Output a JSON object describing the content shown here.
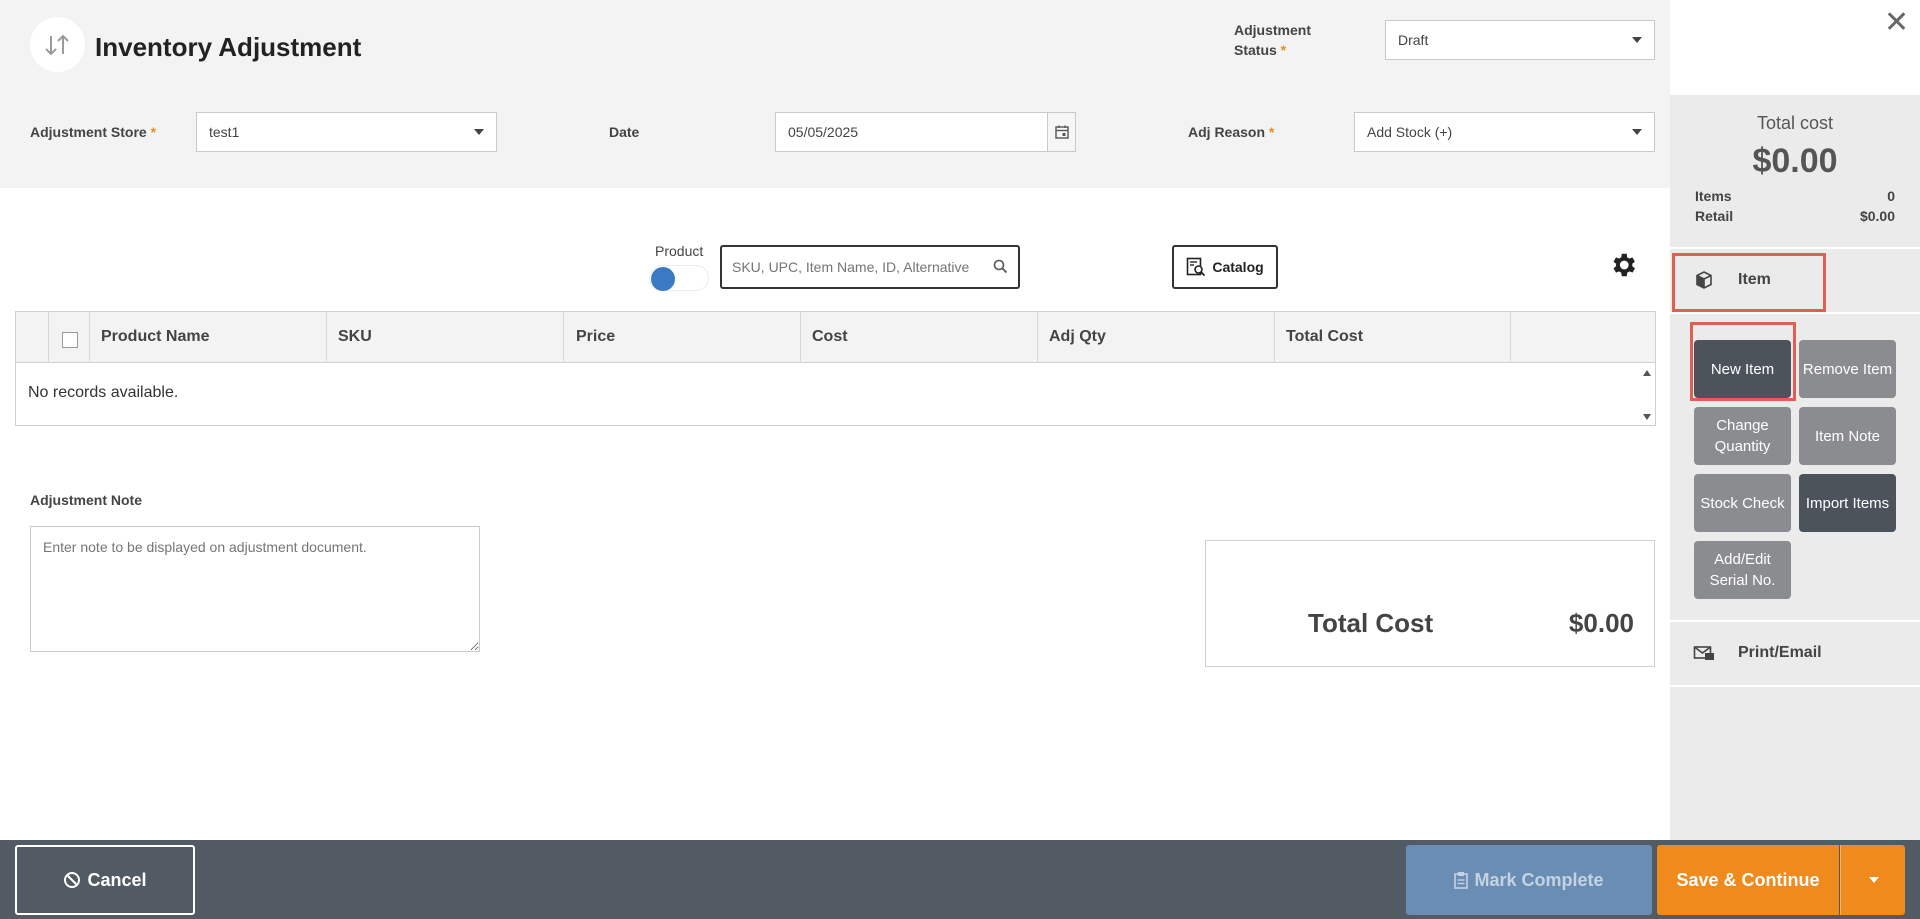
{
  "header": {
    "title": "Inventory Adjustment",
    "status_label_line1": "Adjustment",
    "status_label_line2": "Status",
    "status_value": "Draft",
    "close_symbol": "✕",
    "logo_icon": "swap-arrows-icon"
  },
  "form": {
    "store_label": "Adjustment Store",
    "store_value": "test1",
    "date_label": "Date",
    "date_value": "05/05/2025",
    "reason_label": "Adj Reason",
    "reason_value": "Add Stock (+)",
    "required_marker": "*",
    "required_color": "#f08a1c"
  },
  "search": {
    "toggle_label": "Product",
    "placeholder": "SKU, UPC, Item Name, ID, Alternative",
    "catalog_label": "Catalog"
  },
  "table": {
    "columns": [
      "Product Name",
      "SKU",
      "Price",
      "Cost",
      "Adj Qty",
      "Total Cost"
    ],
    "empty_text": "No records available."
  },
  "note": {
    "label": "Adjustment Note",
    "placeholder": "Enter note to be displayed on adjustment document."
  },
  "summary": {
    "total_label": "Total Cost",
    "total_value": "$0.00"
  },
  "side_panel": {
    "total_cost_label": "Total cost",
    "total_cost_value": "$0.00",
    "items_label": "Items",
    "items_value": "0",
    "retail_label": "Retail",
    "retail_value": "$0.00",
    "item_section_label": "Item",
    "print_section_label": "Print/Email",
    "tiles": {
      "new_item": "New Item",
      "remove_item": "Remove Item",
      "change_quantity": "Change Quantity",
      "item_note": "Item Note",
      "stock_check": "Stock Check",
      "import_items": "Import Items",
      "serial_no": "Add/Edit Serial No."
    }
  },
  "footer": {
    "cancel_label": "Cancel",
    "mark_complete_label": "Mark Complete",
    "save_continue_label": "Save & Continue"
  },
  "colors": {
    "accent_orange": "#f08a1c",
    "footer_bg": "#525a63",
    "mark_complete_bg": "#6a8db3",
    "highlight_red": "#e15f52",
    "toggle_blue": "#3a79c4"
  }
}
